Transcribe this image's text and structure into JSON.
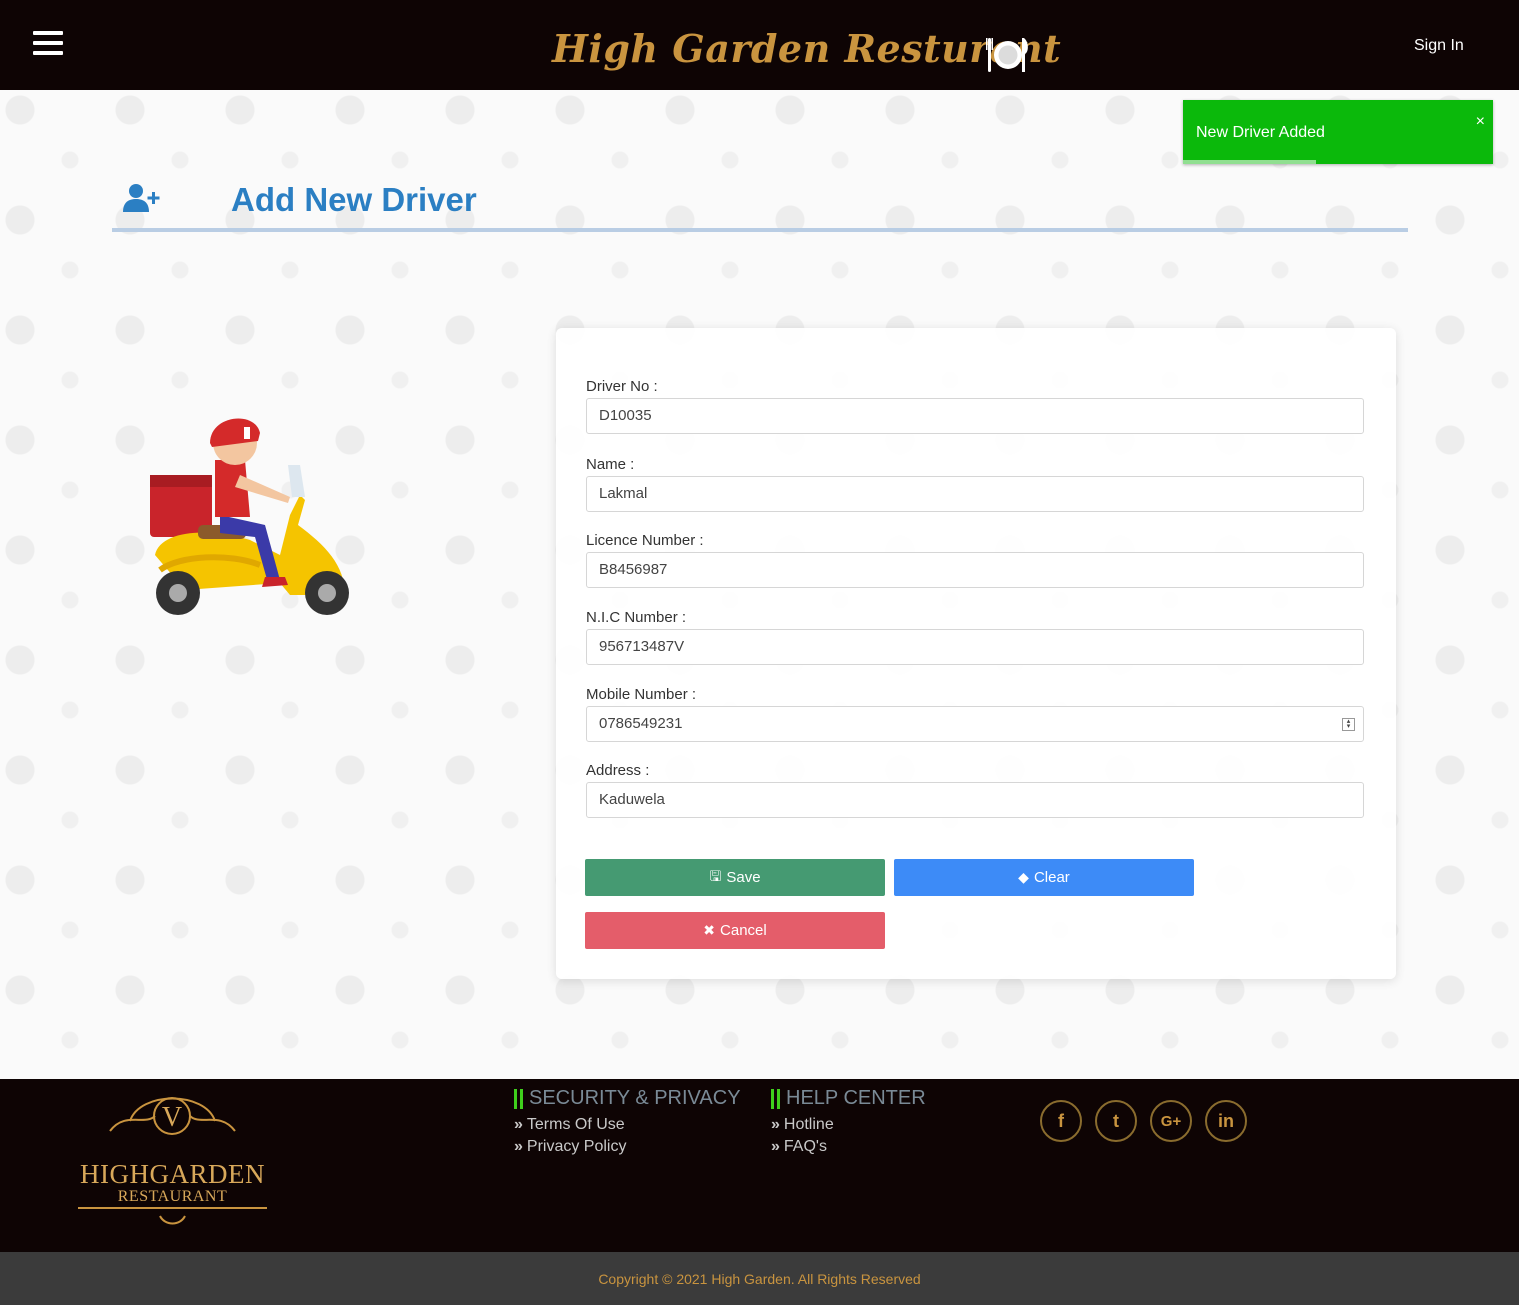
{
  "header": {
    "brand": "High Garden Resturant",
    "sign_in": "Sign In"
  },
  "toast": {
    "message": "New Driver Added",
    "close": "×",
    "progress": 0.43
  },
  "page": {
    "title": "Add New Driver"
  },
  "form": {
    "fields": [
      {
        "label": "Driver No :",
        "value": "D10035"
      },
      {
        "label": "Name :",
        "value": "Lakmal"
      },
      {
        "label": "Licence Number :",
        "value": "B8456987"
      },
      {
        "label": "N.I.C Number :",
        "value": "956713487V"
      },
      {
        "label": "Mobile Number :",
        "value": "0786549231"
      },
      {
        "label": "Address :",
        "value": "Kaduwela"
      }
    ],
    "save_label": "Save",
    "clear_label": "Clear",
    "cancel_label": "Cancel"
  },
  "footer": {
    "logo_line1": "HIGHGARDEN",
    "logo_line2": "RESTAURANT",
    "logo_monogram": "V",
    "security_heading": "SECURITY & PRIVACY",
    "security_links": [
      "Terms Of Use",
      "Privacy Policy"
    ],
    "help_heading": "HELP CENTER",
    "help_links": [
      "Hotline",
      "FAQ's"
    ],
    "social": [
      {
        "icon": "facebook-icon",
        "glyph": "f"
      },
      {
        "icon": "twitter-icon",
        "glyph": "t"
      },
      {
        "icon": "google-plus-icon",
        "glyph": "G+"
      },
      {
        "icon": "linkedin-icon",
        "glyph": "in"
      }
    ],
    "copyright": "Copyright © 2021 High Garden. All Rights Reserved"
  },
  "colors": {
    "header_bg": "#0e0404",
    "brand_gold": "#c9943f",
    "title_blue": "#2b7fc3",
    "toast_green": "#0bb90b",
    "save_green": "#459a72",
    "clear_blue": "#3d8bf7",
    "cancel_red": "#e45d6a"
  }
}
